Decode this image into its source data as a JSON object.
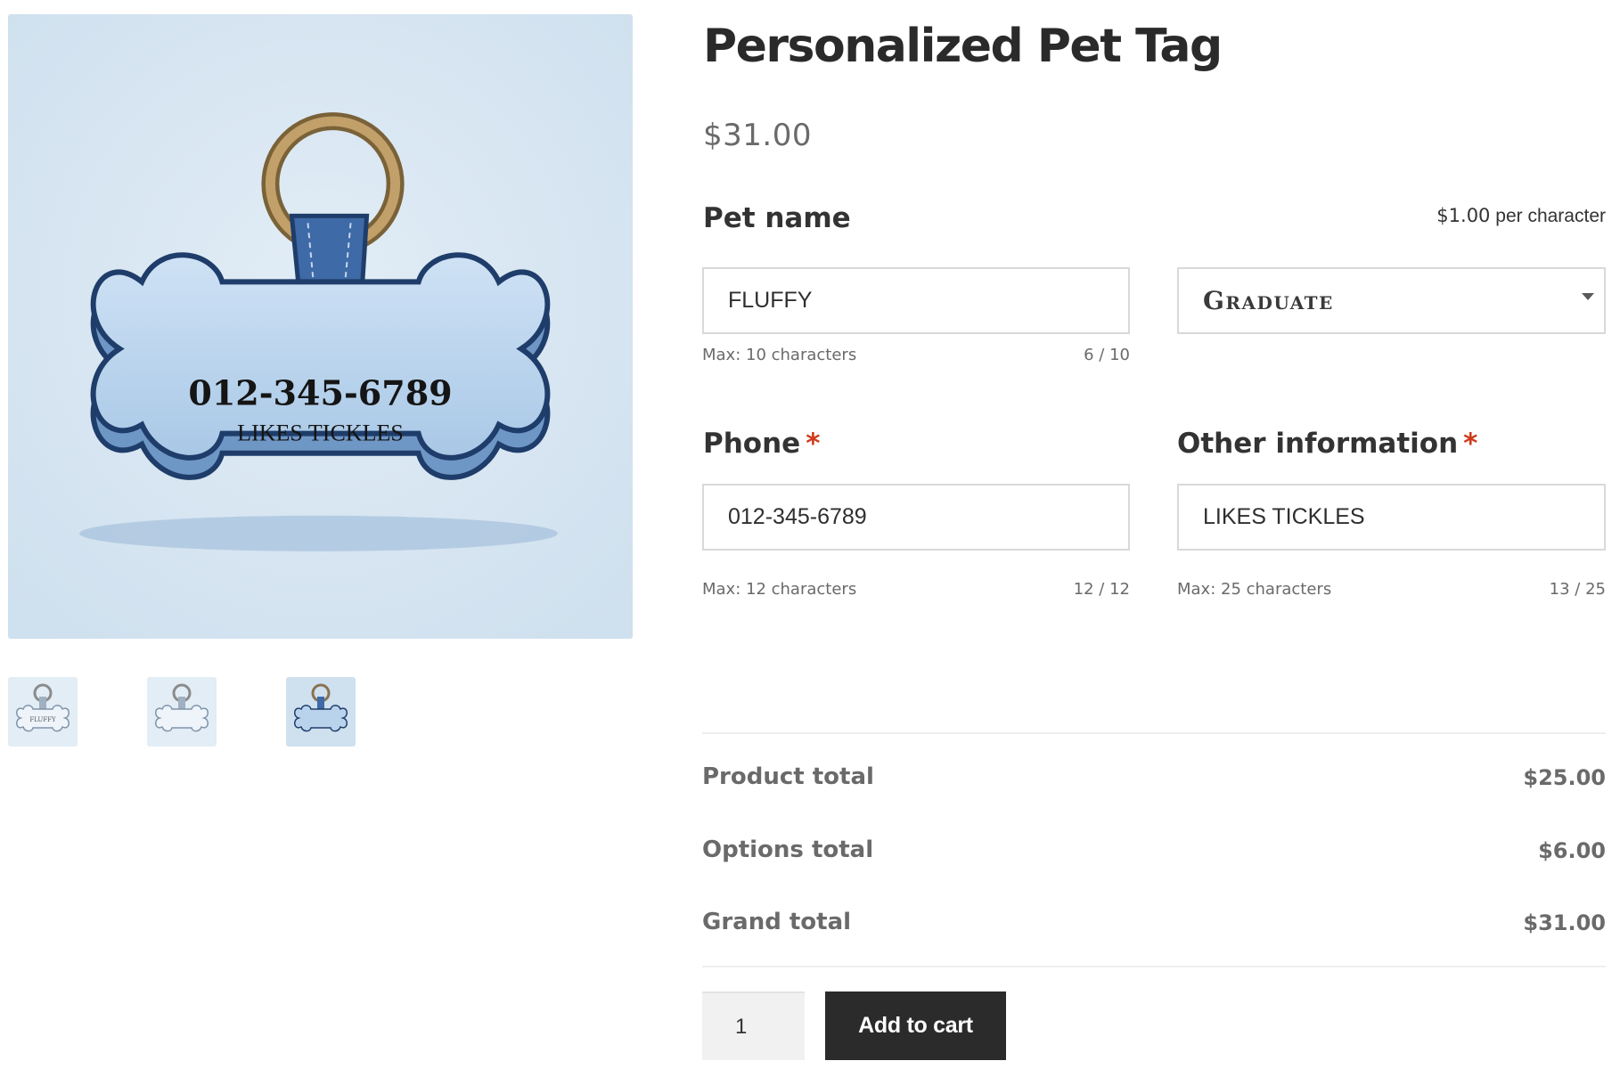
{
  "gallery": {
    "main_image": {
      "tag_phone": "012-345-6789",
      "tag_info": "LIKES TICKLES"
    },
    "thumbnails": [
      {
        "tag_text": "FLUFFY"
      },
      {
        "tag_text": ""
      },
      {
        "tag_text": ""
      }
    ],
    "selected_thumbnail_index": 2
  },
  "product": {
    "title": "Personalized Pet Tag",
    "price": "$31.00"
  },
  "fields": {
    "pet_name": {
      "label": "Pet name",
      "price_amount": "$1.00",
      "price_unit": "per character",
      "value": "FLUFFY",
      "hint": "Max: 10 characters",
      "count": "6 / 10"
    },
    "font_select": {
      "selected": "Graduate"
    },
    "phone": {
      "label": "Phone",
      "required_mark": "*",
      "value": "012-345-6789",
      "hint": "Max: 12 characters",
      "count": "12 / 12"
    },
    "other_info": {
      "label": "Other information",
      "required_mark": "*",
      "value": "LIKES TICKLES",
      "hint": "Max: 25 characters",
      "count": "13 / 25"
    }
  },
  "totals": {
    "product_total_label": "Product total",
    "product_total_value": "$25.00",
    "options_total_label": "Options total",
    "options_total_value": "$6.00",
    "grand_total_label": "Grand total",
    "grand_total_value": "$31.00"
  },
  "cart": {
    "quantity": "1",
    "add_to_cart_label": "Add to cart"
  },
  "colors": {
    "required": "#d0391c",
    "button_bg": "#2b2b2b",
    "image_bg": "#d7e6f1",
    "tag_blue": "#b9d3ec"
  }
}
